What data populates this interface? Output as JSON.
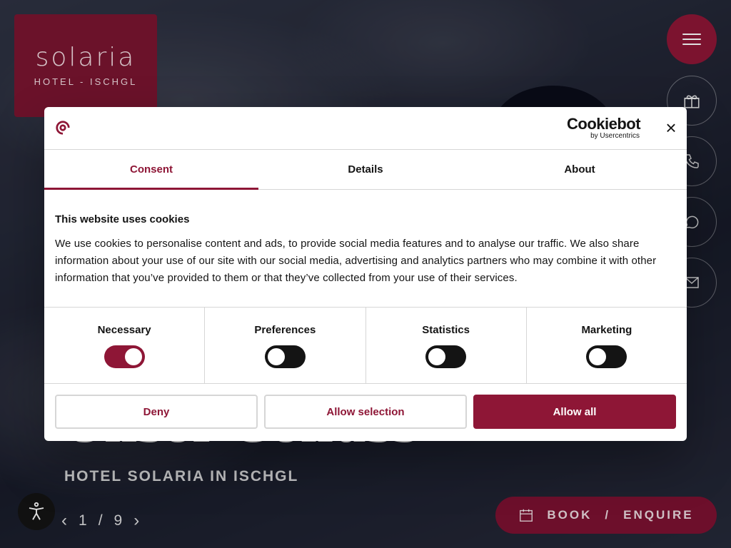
{
  "background": {
    "logo": {
      "word": "solaria",
      "subtitle": "HOTEL - ISCHGL"
    },
    "hero_title": "Unser Genuss",
    "hero_subtitle": "HOTEL SOLARIA IN ISCHGL",
    "slider": {
      "current": "1",
      "separator": "/",
      "total": "9"
    },
    "book_button": {
      "label_book": "BOOK",
      "separator": "/",
      "label_enquire": "ENQUIRE"
    },
    "side_icons": [
      "gift-icon",
      "phone-icon",
      "whatsapp-icon",
      "mail-icon"
    ],
    "colors": {
      "brand": "#8e1636",
      "logo_bg": "#7a1530"
    }
  },
  "dialog": {
    "brand": {
      "name": "Cookiebot",
      "by": "by Usercentrics"
    },
    "tabs": [
      {
        "label": "Consent",
        "active": true
      },
      {
        "label": "Details",
        "active": false
      },
      {
        "label": "About",
        "active": false
      }
    ],
    "heading": "This website uses cookies",
    "text": "We use cookies to personalise content and ads, to provide social media features and to analyse our traffic. We also share information about your use of our site with our social media, advertising and analytics partners who may combine it with other information that you’ve provided to them or that they’ve collected from your use of their services.",
    "categories": [
      {
        "label": "Necessary",
        "enabled": true
      },
      {
        "label": "Preferences",
        "enabled": false
      },
      {
        "label": "Statistics",
        "enabled": false
      },
      {
        "label": "Marketing",
        "enabled": false
      }
    ],
    "buttons": {
      "deny": "Deny",
      "allow_selection": "Allow selection",
      "allow_all": "Allow all"
    },
    "colors": {
      "accent": "#8e1636",
      "toggle_off": "#141414",
      "border": "#d6d6d6"
    }
  }
}
